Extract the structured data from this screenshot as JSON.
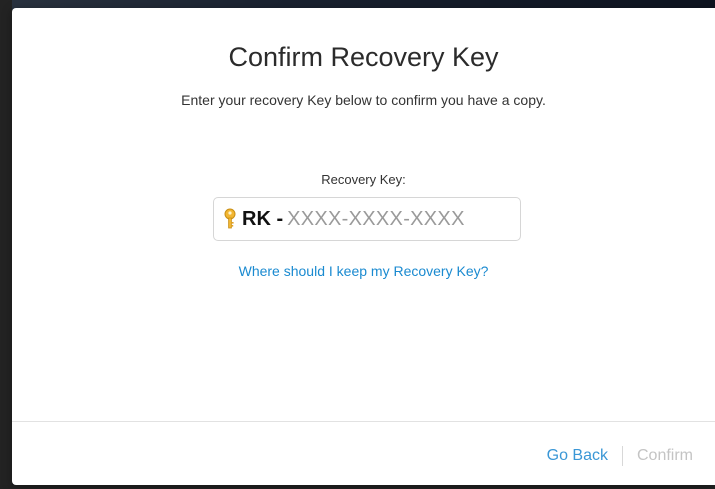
{
  "dialog": {
    "title": "Confirm Recovery Key",
    "subtitle": "Enter your recovery Key below to confirm you have a copy.",
    "field_label": "Recovery Key:",
    "input": {
      "prefix": "RK -",
      "placeholder": "XXXX-XXXX-XXXX",
      "value": "",
      "icon": "key-icon"
    },
    "help_link": "Where should I keep my Recovery Key?",
    "buttons": {
      "go_back": "Go Back",
      "confirm": "Confirm"
    }
  },
  "colors": {
    "link": "#1a8ad0",
    "disabled": "#c4c4c4",
    "key_icon": "#f2b632"
  }
}
